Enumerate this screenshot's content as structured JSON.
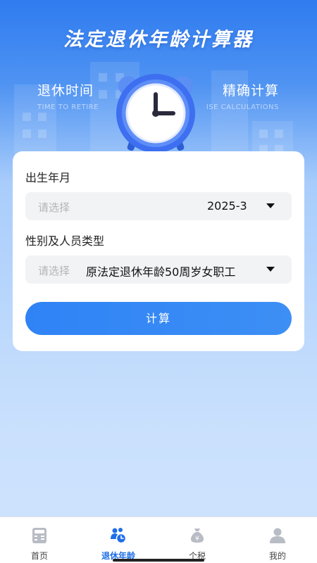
{
  "header": {
    "title": "法定退休年龄计算器",
    "left_tag": {
      "main": "退休时间",
      "sub": "TIME TO RETIRE"
    },
    "right_tag": {
      "main": "精确计算",
      "sub": "ISE CALCULATIONS"
    },
    "illustration": "alarm-clock-icon"
  },
  "form": {
    "birth": {
      "label": "出生年月",
      "placeholder": "请选择",
      "value": "2025-3"
    },
    "category": {
      "label": "性别及人员类型",
      "placeholder": "请选择",
      "value": "原法定退休年龄50周岁女职工"
    },
    "submit_label": "计算"
  },
  "tabbar": {
    "active": "退休年龄",
    "items": [
      {
        "label": "首页",
        "icon": "calculator-icon"
      },
      {
        "label": "退休年龄",
        "icon": "retirement-people-icon"
      },
      {
        "label": "个税",
        "icon": "money-bag-icon"
      },
      {
        "label": "我的",
        "icon": "user-icon"
      }
    ]
  },
  "colors": {
    "primary": "#2f83f5",
    "active_tab": "#1f6fe8",
    "inactive_icon": "#b8bcc4"
  }
}
